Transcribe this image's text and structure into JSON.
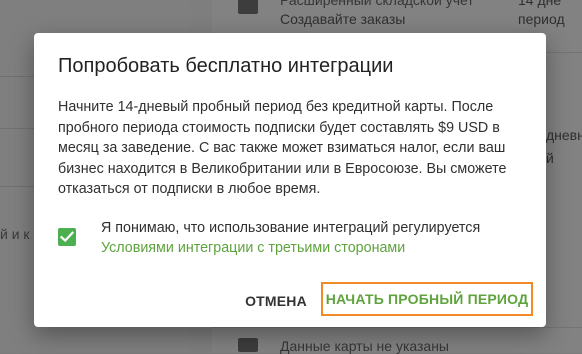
{
  "background": {
    "left_text": "й и к",
    "card_item1_title": "Расширенный складской учет",
    "card_item1_sub": "Создавайте заказы",
    "card_item1_right_top": "14 дне",
    "card_item1_right_bottom": "период",
    "card_item2_right": "дневны",
    "card_item3_right": "й",
    "card_item4_title": "Данные карты не указаны"
  },
  "dialog": {
    "title": "Попробовать бесплатно интеграции",
    "body": "Начните 14-дневый пробный период без кредитной карты. После пробного периода стоимость подписки будет составлять $9 USD в месяц за заведение. С вас также может взиматься налог, если ваш бизнес находится в Великобритании или в Евросоюзе. Вы сможете отказаться от подписки в любое время.",
    "consent_text": "Я понимаю, что использование интеграций регулируется",
    "consent_link": "Условиями интеграции с третьими сторонами",
    "consent_checked": true,
    "cancel_label": "ОТМЕНА",
    "trial_label": "НАЧАТЬ ПРОБНЫЙ ПЕРИОД"
  },
  "colors": {
    "accent_green": "#5ea33d",
    "checkbox_green": "#4caf50",
    "highlight_orange": "#f08a24"
  },
  "icons": [
    "check-icon",
    "warehouse-icon",
    "credit-card-icon"
  ]
}
